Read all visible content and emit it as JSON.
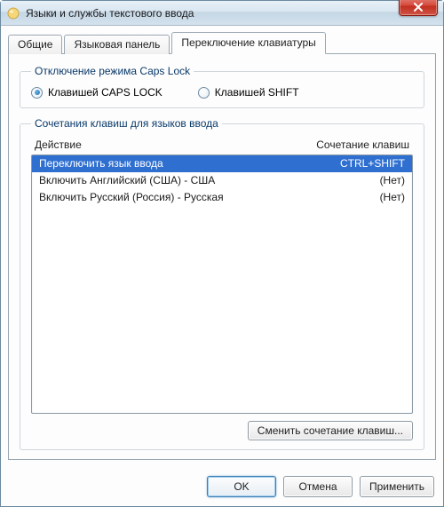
{
  "window": {
    "title": "Языки и службы текстового ввода"
  },
  "tabs": {
    "general": "Общие",
    "langbar": "Языковая панель",
    "switch": "Переключение клавиатуры"
  },
  "capslock_group": {
    "legend": "Отключение режима Caps Lock",
    "opt_caps": "Клавишей CAPS LOCK",
    "opt_shift": "Клавишей SHIFT",
    "selected": "caps"
  },
  "hotkeys_group": {
    "legend": "Сочетания клавиш для языков ввода",
    "col_action": "Действие",
    "col_combo": "Сочетание клавиш",
    "rows": [
      {
        "action": "Переключить язык ввода",
        "combo": "CTRL+SHIFT",
        "selected": true
      },
      {
        "action": "Включить Английский (США) - США",
        "combo": "(Нет)",
        "selected": false
      },
      {
        "action": "Включить Русский (Россия) - Русская",
        "combo": "(Нет)",
        "selected": false
      }
    ],
    "change_btn": "Сменить сочетание клавиш..."
  },
  "buttons": {
    "ok": "OK",
    "cancel": "Отмена",
    "apply": "Применить"
  }
}
